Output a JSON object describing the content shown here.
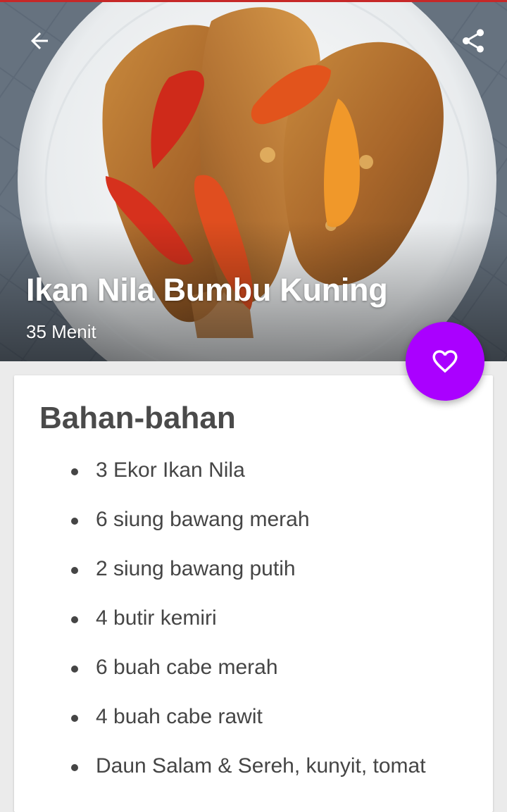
{
  "recipe": {
    "title": "Ikan Nila Bumbu Kuning",
    "duration": "35 Menit"
  },
  "icons": {
    "back": "arrow-back-icon",
    "share": "share-icon",
    "favorite": "heart-outline-icon"
  },
  "colors": {
    "fab_accent": "#aa00ff",
    "top_accent": "#c62828"
  },
  "ingredients_section": {
    "title": "Bahan-bahan",
    "items": [
      "3 Ekor Ikan Nila",
      "6 siung bawang merah",
      "2 siung bawang putih",
      "4 butir kemiri",
      "6 buah cabe merah",
      "4 buah cabe rawit",
      "Daun Salam & Sereh, kunyit, tomat"
    ]
  }
}
